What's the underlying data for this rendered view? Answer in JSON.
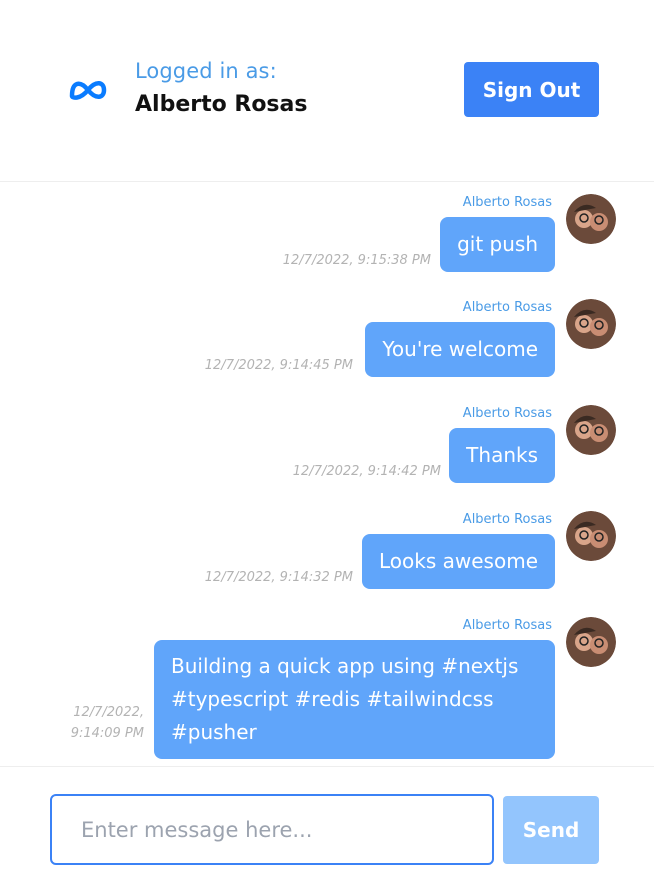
{
  "header": {
    "logged_in_label": "Logged in as:",
    "user_name": "Alberto Rosas",
    "sign_out_label": "Sign Out",
    "logo_icon": "meta-logo-icon",
    "brand_color": "#0a7cff"
  },
  "messages": [
    {
      "sender": "Alberto Rosas",
      "text": "git push",
      "time": "12/7/2022, 9:15:38 PM"
    },
    {
      "sender": "Alberto Rosas",
      "text": "You're welcome",
      "time": "12/7/2022, 9:14:45 PM"
    },
    {
      "sender": "Alberto Rosas",
      "text": "Thanks",
      "time": "12/7/2022, 9:14:42 PM"
    },
    {
      "sender": "Alberto Rosas",
      "text": "Looks awesome",
      "time": "12/7/2022, 9:14:32 PM"
    },
    {
      "sender": "Alberto Rosas",
      "text": "Building a quick app using #nextjs #typescript #redis #tailwindcss #pusher",
      "time": "12/7/2022, 9:14:09 PM"
    }
  ],
  "composer": {
    "placeholder": "Enter message here...",
    "value": "",
    "send_label": "Send"
  },
  "colors": {
    "accent": "#3b82f6",
    "bubble": "#60a5fa",
    "sender_text": "#4a9be6",
    "send_disabled": "#93c5fd"
  }
}
